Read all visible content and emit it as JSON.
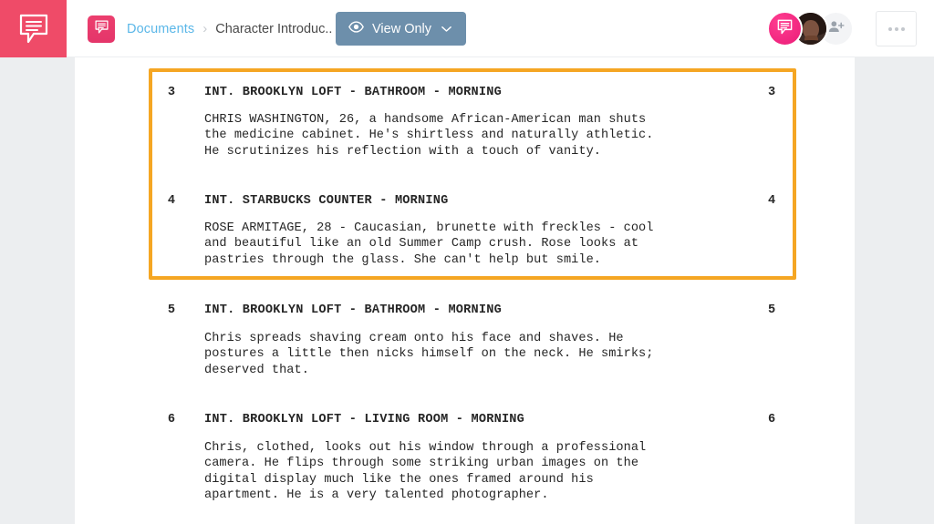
{
  "app": {
    "brand_color": "#ef4b68",
    "logo_icon": "script-speech-bubble-icon"
  },
  "header": {
    "breadcrumb": {
      "doc_icon": "document-speech-bubble-icon",
      "root_label": "Documents",
      "separator": "›",
      "current_label": "Character Introduc.."
    },
    "view_mode_button": {
      "label": "View Only",
      "eye_icon": "eye-icon",
      "chevron_icon": "chevron-down-icon",
      "background_color": "#6d8fab"
    },
    "avatars": [
      {
        "name": "avatar-brand",
        "type": "brand-logo",
        "color": "#ea1c78"
      },
      {
        "name": "avatar-collaborator-photo",
        "type": "photo"
      },
      {
        "name": "avatar-add-collaborator",
        "type": "add-person-icon",
        "color": "#f3f4f6"
      }
    ],
    "more_button": {
      "icon": "three-dots-icon",
      "dots": [
        "•",
        "•",
        "•"
      ]
    }
  },
  "document": {
    "highlight_color": "#f5a623",
    "highlighted_scenes": [
      3,
      4
    ],
    "scenes": [
      {
        "number": "3",
        "heading": "INT. BROOKLYN LOFT - BATHROOM - MORNING",
        "action": "CHRIS WASHINGTON, 26, a handsome African-American man shuts\nthe medicine cabinet. He's shirtless and naturally athletic.\nHe scrutinizes his reflection with a touch of vanity."
      },
      {
        "number": "4",
        "heading": "INT. STARBUCKS COUNTER - MORNING",
        "action": "ROSE ARMITAGE, 28 - Caucasian, brunette with freckles - cool\nand beautiful like an old Summer Camp crush. Rose looks at\npastries through the glass. She can't help but smile."
      },
      {
        "number": "5",
        "heading": "INT. BROOKLYN LOFT - BATHROOM - MORNING",
        "action": "Chris spreads shaving cream onto his face and shaves. He\npostures a little then nicks himself on the neck. He smirks;\ndeserved that."
      },
      {
        "number": "6",
        "heading": "INT. BROOKLYN LOFT - LIVING ROOM - MORNING",
        "action": "Chris, clothed, looks out his window through a professional\ncamera. He flips through some striking urban images on the\ndigital display much like the ones framed around his\napartment. He is a very talented photographer."
      }
    ]
  }
}
